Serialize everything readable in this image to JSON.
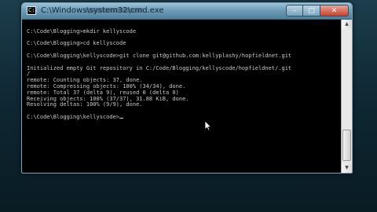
{
  "window": {
    "title": "C:\\Windows\\system32\\cmd.exe",
    "controls": {
      "minimize": "–",
      "maximize": "□",
      "close": "✕"
    }
  },
  "console": {
    "lines": [
      "",
      "C:\\Code\\Blogging>mkdir kellyscode",
      "",
      "C:\\Code\\Blogging>cd kellyscode",
      "",
      "C:\\Code\\Blogging\\kellyscode>git clone git@github.com:kellyplashy/hopfieldnet.git",
      "",
      "Initialized empty Git repository in C:/Code/Blogging/kellyscode/hopfieldnet/.git",
      "/",
      "remote: Counting objects: 37, done.",
      "remote: Compressing objects: 100% (34/34), done.",
      "remote: Total 37 (delta 9), reused 0 (delta 0)",
      "Receiving objects: 100% (37/37), 31.88 KiB, done.",
      "Resolving deltas: 100% (9/9), done.",
      "",
      "C:\\Code\\Blogging\\kellyscode>"
    ]
  },
  "colors": {
    "console_bg": "#000000",
    "console_text": "#c8c8c8",
    "titlebar": "#6f9db8",
    "close_button": "#c7432d"
  }
}
